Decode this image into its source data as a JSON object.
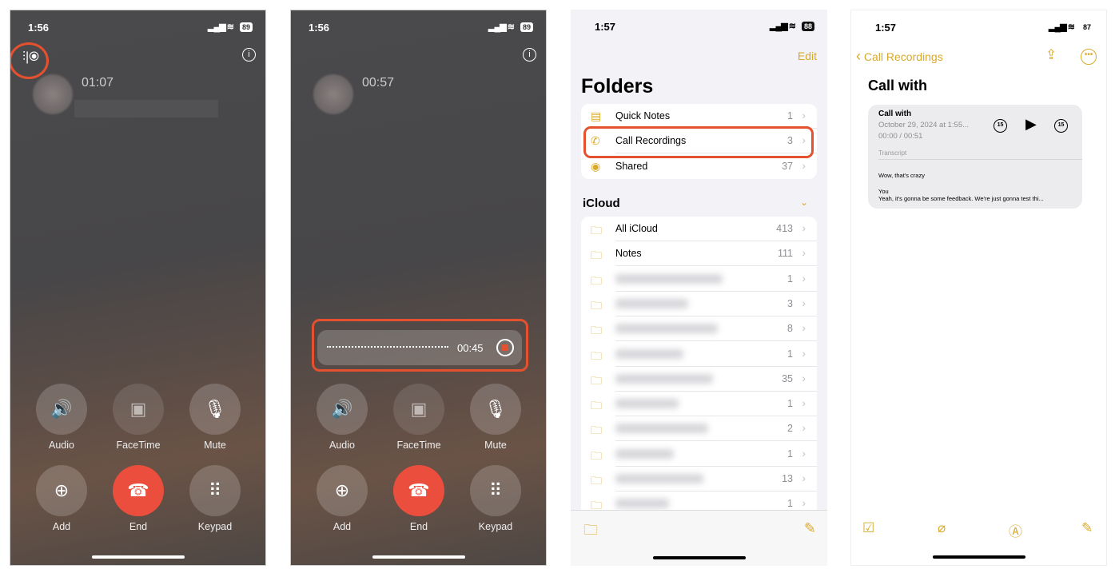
{
  "call1": {
    "time": "1:56",
    "battery": "89",
    "duration": "01:07",
    "buttons": [
      {
        "label": "Audio",
        "icon": "speaker-icon"
      },
      {
        "label": "FaceTime",
        "icon": "video-icon"
      },
      {
        "label": "Mute",
        "icon": "mic-off-icon"
      },
      {
        "label": "Add",
        "icon": "add-person-icon"
      },
      {
        "label": "End",
        "icon": "end-call-icon"
      },
      {
        "label": "Keypad",
        "icon": "keypad-icon"
      }
    ]
  },
  "call2": {
    "time": "1:56",
    "battery": "89",
    "duration": "00:57",
    "recording_time": "00:45",
    "buttons": [
      {
        "label": "Audio"
      },
      {
        "label": "FaceTime"
      },
      {
        "label": "Mute"
      },
      {
        "label": "Add"
      },
      {
        "label": "End"
      },
      {
        "label": "Keypad"
      }
    ]
  },
  "folders": {
    "time": "1:57",
    "battery": "88",
    "edit": "Edit",
    "title": "Folders",
    "top": [
      {
        "name": "Quick Notes",
        "count": "1"
      },
      {
        "name": "Call Recordings",
        "count": "3"
      },
      {
        "name": "Shared",
        "count": "37"
      }
    ],
    "section": "iCloud",
    "icloud": [
      {
        "name": "All iCloud",
        "count": "413"
      },
      {
        "name": "Notes",
        "count": "111"
      },
      {
        "name": "",
        "count": "1"
      },
      {
        "name": "",
        "count": "3"
      },
      {
        "name": "",
        "count": "8"
      },
      {
        "name": "",
        "count": "1"
      },
      {
        "name": "",
        "count": "35"
      },
      {
        "name": "",
        "count": "1"
      },
      {
        "name": "",
        "count": "2"
      },
      {
        "name": "",
        "count": "1"
      },
      {
        "name": "",
        "count": "13"
      },
      {
        "name": "",
        "count": "1"
      }
    ]
  },
  "note": {
    "time": "1:57",
    "battery": "87",
    "back": "Call Recordings",
    "title": "Call with",
    "card": {
      "title": "Call with",
      "date": "October 29, 2024 at 1:55...",
      "progress": "00:00 / 00:51",
      "skip": "15",
      "transcript_label": "Transcript",
      "line1": "Wow, that's crazy",
      "speaker": "You",
      "line2": "Yeah, it's gonna be some feedback. We're just gonna test thi..."
    }
  },
  "colors": {
    "highlight": "#e5512f",
    "accent": "#d9a92a",
    "end": "#eb4e3d"
  }
}
